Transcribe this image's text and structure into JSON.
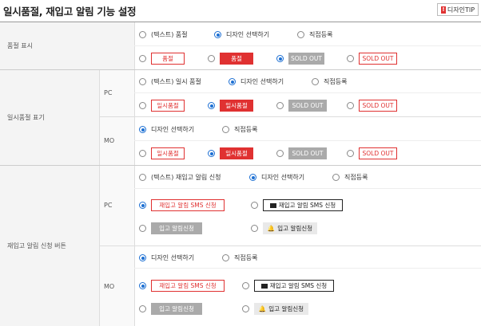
{
  "title": "일시품절, 재입고 알림 기능 설정",
  "tip_button": "디자인TIP",
  "rows": {
    "sold_out_display": {
      "label": "품절 표시",
      "options": [
        "(텍스트) 품절",
        "디자인 선택하기",
        "직접등록"
      ],
      "swatches": [
        "품절",
        "품절",
        "SOLD OUT",
        "SOLD OUT"
      ]
    },
    "temp_sold_out": {
      "label": "일시품절 표기",
      "pc": {
        "label": "PC",
        "options": [
          "(텍스트) 일시 품절",
          "디자인 선택하기",
          "직접등록"
        ],
        "swatches": [
          "일시품절",
          "일시품절",
          "SOLD OUT",
          "SOLD OUT"
        ]
      },
      "mo": {
        "label": "MO",
        "options": [
          "디자인 선택하기",
          "직접등록"
        ],
        "swatches": [
          "일시품절",
          "일시품절",
          "SOLD OUT",
          "SOLD OUT"
        ]
      }
    },
    "restock_button": {
      "label": "재입고 알림 신청 버튼",
      "pc": {
        "label": "PC",
        "options": [
          "(텍스트) 재입고 알림 신청",
          "디자인 선택하기",
          "직접등록"
        ],
        "swatches": [
          "재입고 알림 SMS 신청",
          "재입고 알림 SMS 신청",
          "입고 알림신청",
          "입고 알림신청"
        ]
      },
      "mo": {
        "label": "MO",
        "options": [
          "디자인 선택하기",
          "직접등록"
        ],
        "swatches": [
          "재입고 알림 SMS 신청",
          "재입고 알림 SMS 신청",
          "입고 알림신청",
          "입고 알림신청"
        ]
      }
    }
  },
  "colors": {
    "accent": "#1c6fd3",
    "red": "#e03131",
    "gray": "#aaaaaa"
  },
  "icons": [
    "mail-icon",
    "bell-icon",
    "exclamation-icon"
  ]
}
